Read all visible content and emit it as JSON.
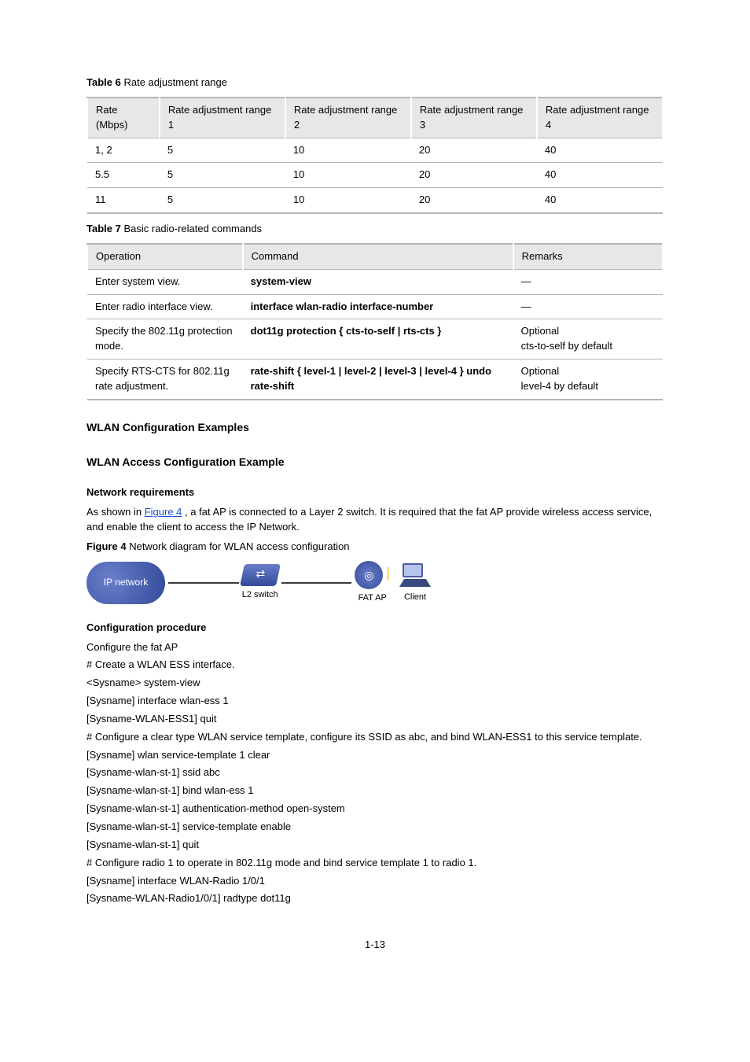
{
  "table1": {
    "caption_label": "Table 6",
    "caption_text": "Rate adjustment range",
    "headers": [
      "Rate (Mbps)",
      "Rate adjustment range 1",
      "Rate adjustment range 2",
      "Rate adjustment range 3",
      "Rate adjustment range 4"
    ],
    "rows": [
      [
        "1, 2",
        "5",
        "10",
        "20",
        "40"
      ],
      [
        "5.5",
        "5",
        "10",
        "20",
        "40"
      ],
      [
        "11",
        "5",
        "10",
        "20",
        "40"
      ]
    ]
  },
  "table2": {
    "caption_label": "Table 7",
    "caption_text": "Basic radio-related commands",
    "headers": [
      "Operation",
      "Command",
      "Remarks"
    ],
    "rows": [
      {
        "op": "Enter system view.",
        "cmd": "system-view",
        "rem": "—"
      },
      {
        "op": "Enter radio interface view.",
        "cmd": "interface wlan-radio interface-number",
        "rem": "—"
      },
      {
        "op": "Specify the 802.11g protection mode.",
        "cmd": "dot11g protection { cts-to-self | rts-cts }",
        "rem": "Optional\ncts-to-self by default"
      },
      {
        "op": "Specify RTS-CTS for 802.11g rate adjustment.",
        "cmd": "rate-shift { level-1 | level-2 | level-3 | level-4 } undo rate-shift",
        "rem": "Optional\nlevel-4 by default"
      }
    ]
  },
  "sections": {
    "examples": "WLAN Configuration Examples",
    "access_example": "WLAN Access Configuration Example",
    "net_req": "Network requirements",
    "net_req_body_pre": "As shown in ",
    "net_req_link": "Figure 4",
    "net_req_body_post": ", a fat AP is connected to a Layer 2 switch. It is required that the fat AP provide wireless access service, and enable the client to access the IP Network.",
    "fig_label": "Figure 4",
    "fig_text": "Network diagram for WLAN access configuration",
    "diag": {
      "cloud": "IP network",
      "switch": "L2 switch",
      "ap": "FAT AP",
      "client": "Client"
    },
    "config_proc": "Configuration procedure",
    "config_steps": [
      "Configure the fat AP",
      "# Create a WLAN ESS interface.",
      "<Sysname> system-view",
      "[Sysname] interface wlan-ess 1",
      "[Sysname-WLAN-ESS1] quit",
      "# Configure a clear type  WLAN service template, configure its SSID as abc, and bind WLAN-ESS1 to this service template.",
      "[Sysname] wlan service-template 1 clear",
      "[Sysname-wlan-st-1] ssid abc",
      "[Sysname-wlan-st-1] bind wlan-ess 1",
      "[Sysname-wlan-st-1] authentication-method open-system",
      "[Sysname-wlan-st-1] service-template enable",
      "[Sysname-wlan-st-1] quit",
      "# Configure radio 1 to operate in 802.11g mode and bind service template 1 to radio 1.",
      "[Sysname] interface WLAN-Radio 1/0/1",
      "[Sysname-WLAN-Radio1/0/1] radtype dot11g"
    ]
  },
  "page_num": "1-13"
}
